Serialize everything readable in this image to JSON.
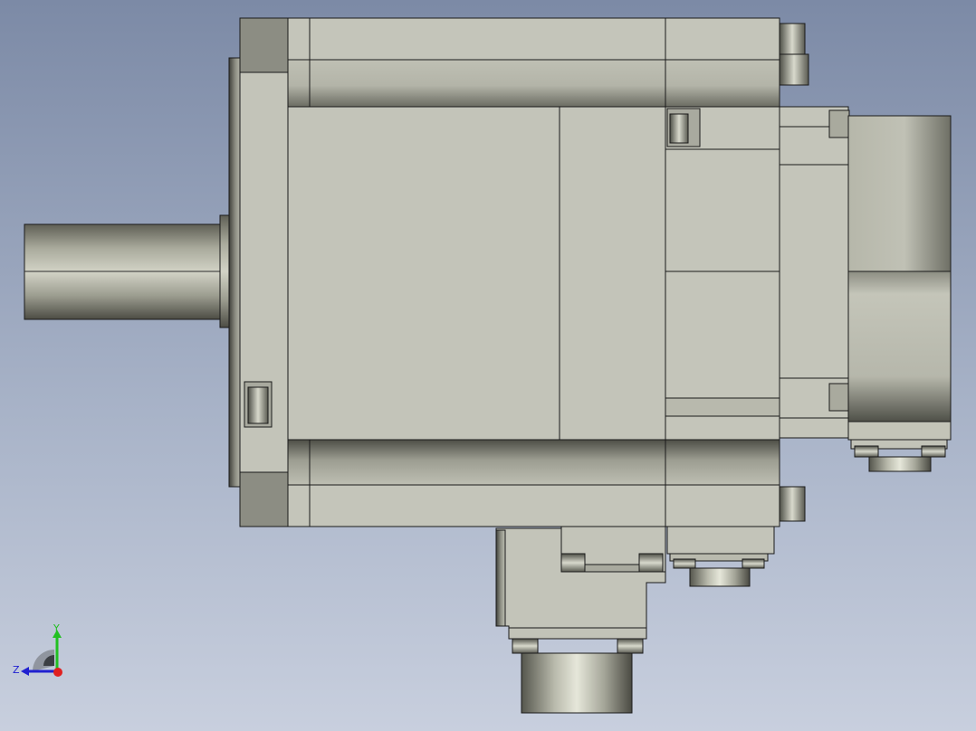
{
  "viewport": {
    "background_top": "#7c8aa6",
    "background_bottom": "#c8cfde"
  },
  "model": {
    "body_color": "#c2c3b8",
    "edge_color": "#1a1a1a"
  },
  "triad": {
    "y_label": "Y",
    "z_label": "Z",
    "y_color": "#22c022",
    "z_color": "#2020d0",
    "x_color": "#e02020"
  }
}
